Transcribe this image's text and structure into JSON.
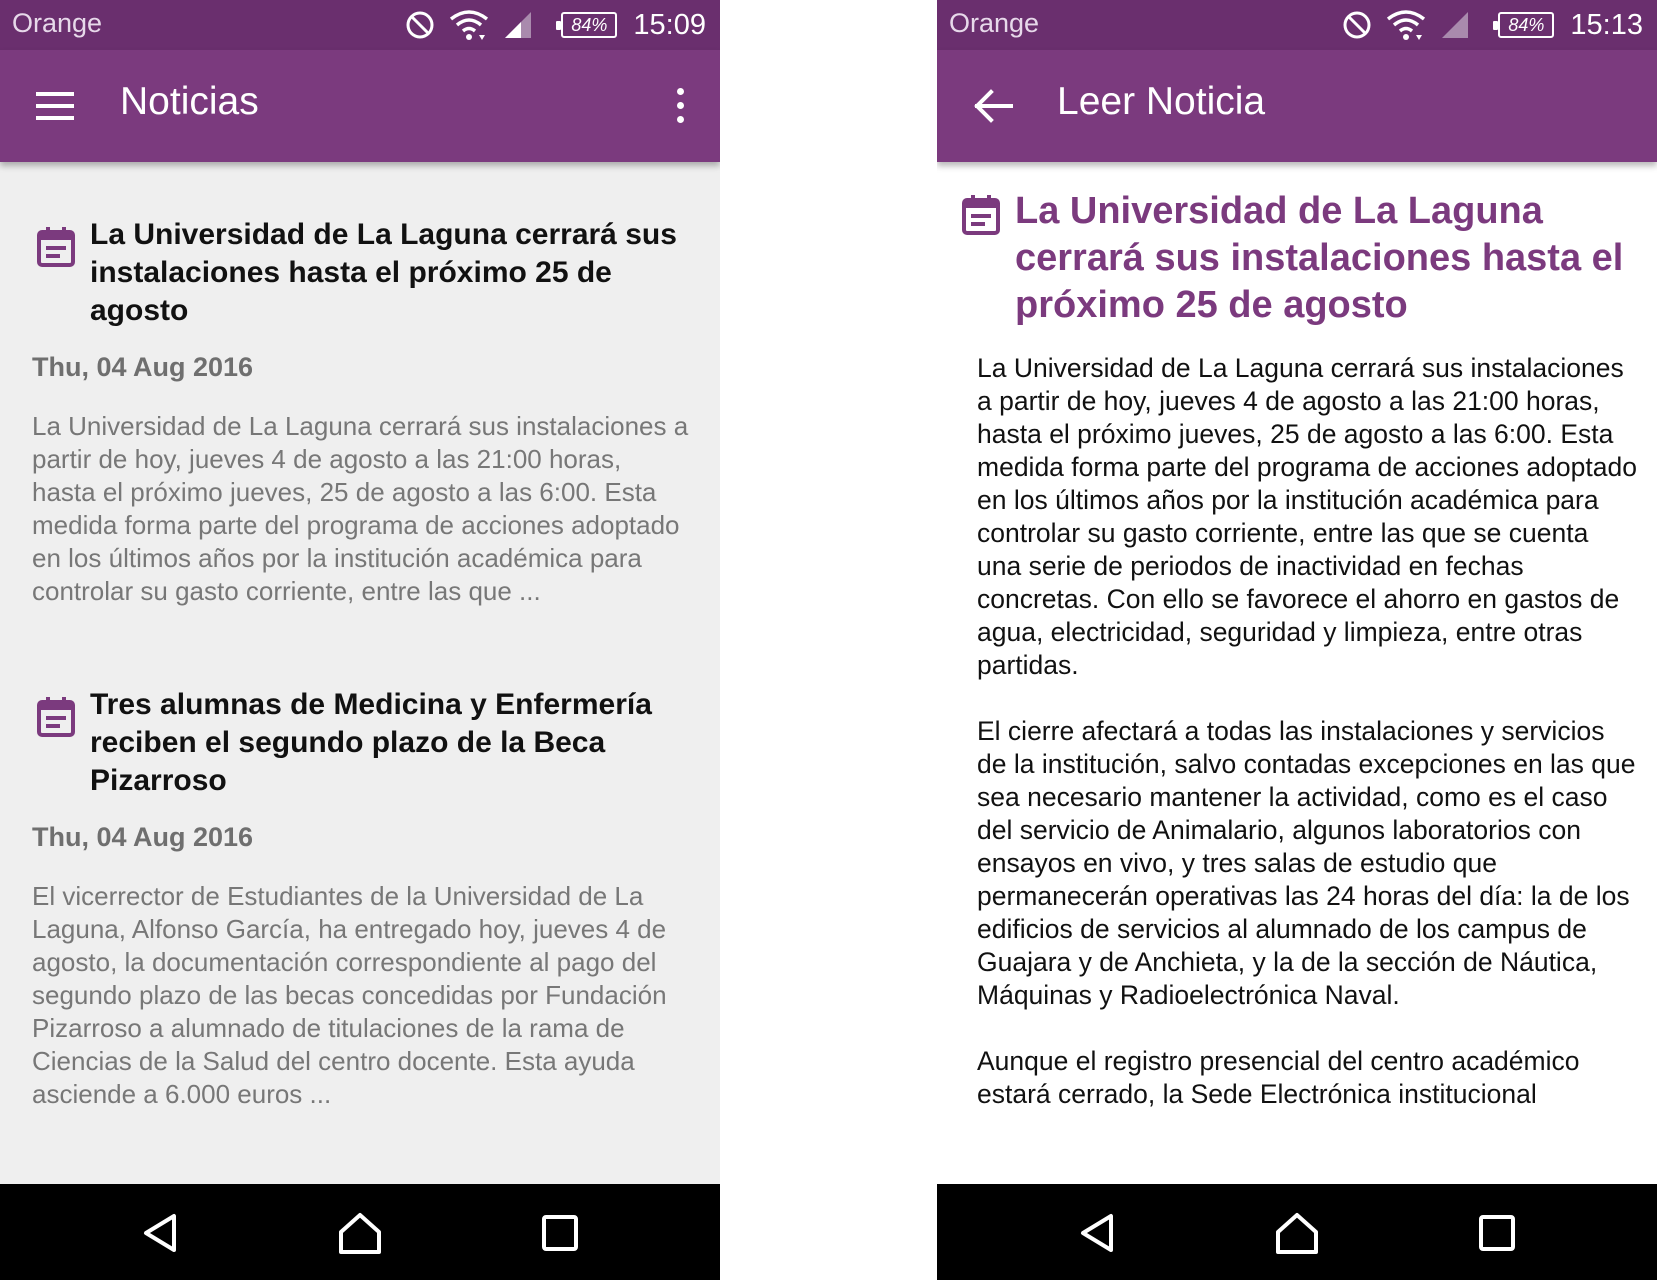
{
  "colors": {
    "status_bar": "#6a2f6e",
    "app_bar": "#7b3a7e",
    "accent": "#7b3a7e",
    "list_bg": "#efefef"
  },
  "left": {
    "status": {
      "carrier": "Orange",
      "battery": "84%",
      "time": "15:09"
    },
    "app_bar": {
      "title": "Noticias",
      "nav_icon": "menu-icon",
      "action_icon": "more-vert-icon"
    },
    "news": [
      {
        "title": "La Universidad de La Laguna cerrará sus instalaciones hasta el próximo 25 de agosto",
        "date": "Thu, 04 Aug 2016",
        "summary": "La Universidad de La Laguna cerrará sus instalaciones a partir de hoy, jueves 4 de agosto a las 21:00 horas, hasta el próximo jueves, 25 de agosto a las 6:00. Esta medida forma parte del programa de acciones adoptado en los últimos años por la institución académica para controlar su gasto corriente, entre las que ..."
      },
      {
        "title": "Tres alumnas de Medicina y Enfermería reciben el segundo plazo de la Beca Pizarroso",
        "date": "Thu, 04 Aug 2016",
        "summary": "El vicerrector de Estudiantes de la Universidad de La Laguna, Alfonso García, ha entregado hoy, jueves 4 de agosto, la documentación correspondiente al pago del segundo plazo de las becas concedidas por Fundación Pizarroso a alumnado de titulaciones de la rama de Ciencias de la Salud del centro docente. Esta ayuda asciende a 6.000 euros ..."
      }
    ]
  },
  "right": {
    "status": {
      "carrier": "Orange",
      "battery": "84%",
      "time": "15:13"
    },
    "app_bar": {
      "title": "Leer Noticia",
      "nav_icon": "back-arrow-icon"
    },
    "article": {
      "title": "La Universidad de La Laguna cerrará sus instalaciones hasta el próximo 25 de agosto",
      "paragraphs": [
        "La Universidad de La Laguna cerrará sus instalaciones a partir de hoy, jueves 4 de agosto a las 21:00 horas, hasta el próximo jueves, 25 de agosto a las 6:00. Esta medida forma parte del programa de acciones adoptado en los últimos años por la institución académica para controlar su gasto corriente, entre las que se cuenta una serie de periodos de inactividad en fechas concretas. Con ello se favorece el ahorro en gastos de agua, electricidad, seguridad y limpieza, entre otras partidas.",
        "El cierre afectará a todas las instalaciones y servicios de la institución, salvo contadas excepciones en las que sea necesario mantener la actividad, como es el caso del servicio de Animalario, algunos laboratorios con ensayos en vivo, y tres salas de estudio que permanecerán operativas las 24 horas del día: la de los edificios de servicios al alumnado de los campus de Guajara y de Anchieta, y la de la sección de Náutica, Máquinas y Radioelectrónica Naval.",
        "Aunque el registro presencial del centro académico estará cerrado, la Sede Electrónica institucional"
      ]
    }
  },
  "navbar": {
    "icons": [
      "back-triangle-icon",
      "home-icon",
      "recents-square-icon"
    ]
  }
}
